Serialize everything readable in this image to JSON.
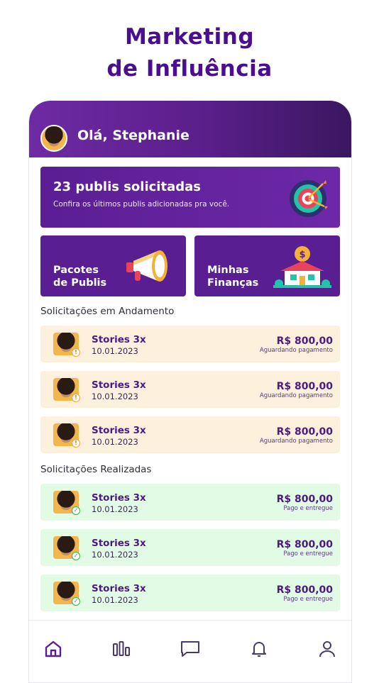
{
  "headline": {
    "line1": "Marketing",
    "line2": "de Influência"
  },
  "header": {
    "greeting": "Olá, Stephanie"
  },
  "banner": {
    "title": "23 publis solicitadas",
    "subtitle": "Confira os últimos publis adicionadas pra você.",
    "icon": "target-icon"
  },
  "tiles": [
    {
      "label": "Pacotes\nde Publis",
      "icon": "megaphone-icon"
    },
    {
      "label": "Minhas\nFinanças",
      "icon": "house-money-icon"
    }
  ],
  "sections": {
    "pending_title": "Solicitações em Andamento",
    "done_title": "Solicitações Realizadas"
  },
  "pending": [
    {
      "title": "Stories 3x",
      "date": "10.01.2023",
      "price": "R$ 800,00",
      "status": "Aguardando pagamento"
    },
    {
      "title": "Stories 3x",
      "date": "10.01.2023",
      "price": "R$ 800,00",
      "status": "Aguardando pagamento"
    },
    {
      "title": "Stories 3x",
      "date": "10.01.2023",
      "price": "R$ 800,00",
      "status": "Aguardando pagamento"
    }
  ],
  "done": [
    {
      "title": "Stories 3x",
      "date": "10.01.2023",
      "price": "R$ 800,00",
      "status": "Pago e entregue"
    },
    {
      "title": "Stories 3x",
      "date": "10.01.2023",
      "price": "R$ 800,00",
      "status": "Pago e entregue"
    },
    {
      "title": "Stories 3x",
      "date": "10.01.2023",
      "price": "R$ 800,00",
      "status": "Pago e entregue"
    }
  ],
  "tabbar": {
    "items": [
      "home-icon",
      "chart-icon",
      "chat-icon",
      "bell-icon",
      "user-icon"
    ],
    "active": "home-icon"
  },
  "colors": {
    "primary": "#5a1e93",
    "pending_bg": "#fdf0dd",
    "done_bg": "#e2fbe4",
    "headline": "#4a0f8f"
  }
}
